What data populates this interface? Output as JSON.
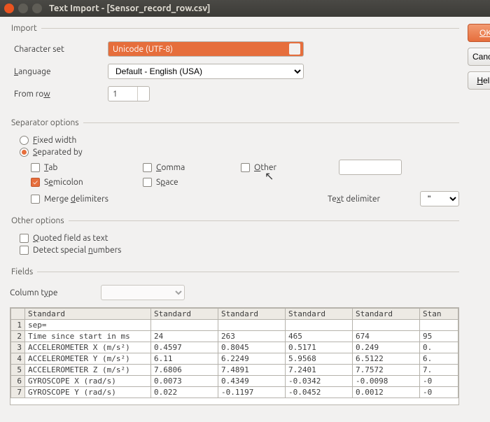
{
  "window": {
    "title": "Text Import - [Sensor_record_row.csv]"
  },
  "buttons": {
    "ok": "OK",
    "cancel": "Cancel",
    "help": "Help"
  },
  "import": {
    "legend": "Import",
    "charset_label": "Character set",
    "charset_value": "Unicode (UTF-8)",
    "language_label": "Language",
    "language_value": "Default - English (USA)",
    "fromrow_label": "From row",
    "fromrow_value": "1"
  },
  "separator": {
    "legend": "Separator options",
    "fixed_width": "Fixed width",
    "separated_by": "Separated by",
    "tab": "Tab",
    "comma": "Comma",
    "other": "Other",
    "semicolon": "Semicolon",
    "space": "Space",
    "merge": "Merge delimiters",
    "text_delim_label": "Text delimiter",
    "text_delim_value": "\""
  },
  "other": {
    "legend": "Other options",
    "quoted": "Quoted field as text",
    "detect": "Detect special numbers"
  },
  "fields": {
    "legend": "Fields",
    "column_type_label": "Column type"
  },
  "preview": {
    "headers": [
      "Standard",
      "Standard",
      "Standard",
      "Standard",
      "Standard",
      "Stan"
    ],
    "rows": [
      {
        "n": "1",
        "c": [
          "sep=",
          "",
          "",
          "",
          "",
          ""
        ]
      },
      {
        "n": "2",
        "c": [
          "Time since start in ms",
          "24",
          "263",
          "465",
          "674",
          "95"
        ]
      },
      {
        "n": "3",
        "c": [
          "ACCELEROMETER X (m/s²)",
          "0.4597",
          "0.8045",
          "0.5171",
          "0.249",
          "0."
        ]
      },
      {
        "n": "4",
        "c": [
          "ACCELEROMETER Y (m/s²)",
          "6.11",
          "6.2249",
          "5.9568",
          "6.5122",
          "6."
        ]
      },
      {
        "n": "5",
        "c": [
          "ACCELEROMETER Z (m/s²)",
          "7.6806",
          "7.4891",
          "7.2401",
          "7.7572",
          "7."
        ]
      },
      {
        "n": "6",
        "c": [
          "GYROSCOPE X (rad/s)",
          "0.0073",
          "0.4349",
          "-0.0342",
          "-0.0098",
          "-0"
        ]
      },
      {
        "n": "7",
        "c": [
          "GYROSCOPE Y (rad/s)",
          "0.022",
          "-0.1197",
          "-0.0452",
          "0.0012",
          "-0"
        ]
      }
    ]
  }
}
